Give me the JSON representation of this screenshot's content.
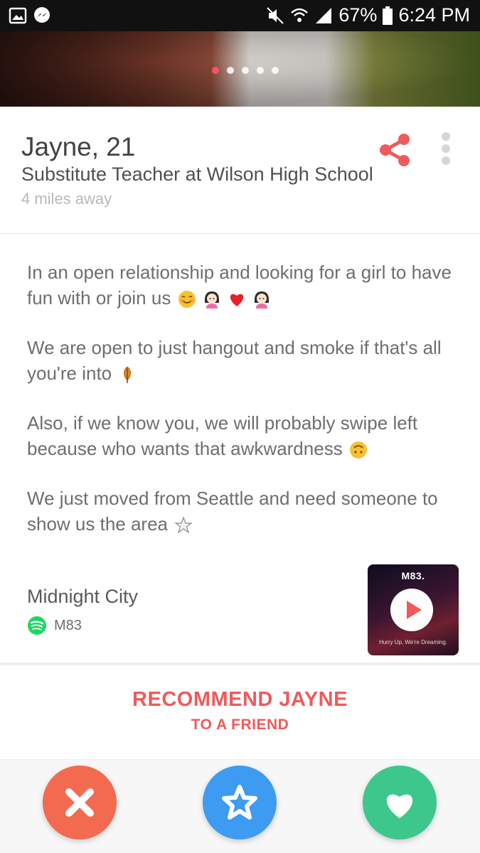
{
  "status_bar": {
    "battery": "67%",
    "time": "6:24 PM"
  },
  "photo": {
    "dot_count": 5,
    "active_dot": 1
  },
  "profile": {
    "name_age": "Jayne, 21",
    "job": "Substitute Teacher at Wilson High School",
    "distance": "4 miles away"
  },
  "bio": {
    "paragraphs": [
      "In an open relationship and looking for a girl to have fun with or join us",
      "We are open to just hangout and smoke if that's all you're into",
      "Also, if we know you, we will probably swipe left because who wants that awkwardness",
      "We just moved from Seattle and need someone to show us the area"
    ],
    "emoji": [
      "smiling-face",
      "girl",
      "red-heart",
      "girl",
      "leaf",
      "upside-down-face",
      "star"
    ]
  },
  "anthem": {
    "song": "Midnight City",
    "artist": "M83",
    "album_artist": "M83.",
    "album_title": "Hurry Up, We're Dreaming."
  },
  "recommend": {
    "line1": "RECOMMEND JAYNE",
    "line2": "TO A FRIEND"
  },
  "actions": {
    "nope_icon": "x-icon",
    "super_like_icon": "star-icon",
    "like_icon": "heart-icon"
  },
  "colors": {
    "accent": "#fd5068",
    "recommend": "#ef5a5a",
    "nope": "#f26a50",
    "super_like": "#3d9bf2",
    "like": "#3dc78c",
    "spotify": "#1ed760"
  }
}
